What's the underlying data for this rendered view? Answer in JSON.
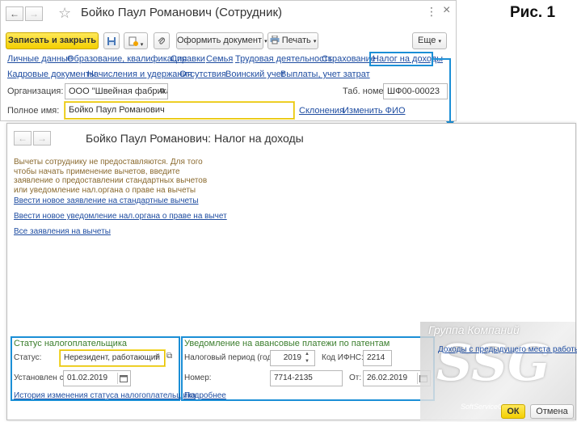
{
  "main_window": {
    "title": "Бойко Паул Романович (Сотрудник)",
    "more_icon": "⋮",
    "close_icon": "×",
    "toolbar": {
      "save_close": "Записать и закрыть",
      "create_document": "Оформить документ",
      "print": "Печать",
      "more": "Еще"
    },
    "nav_row1": [
      "Личные данные",
      "Образование, квалификация",
      "Справки",
      "Семья",
      "Трудовая деятельность",
      "Страхование",
      "Налог на доходы"
    ],
    "nav_row2": [
      "Кадровые документы",
      "Начисления и удержания",
      "Отсутствия",
      "Воинский учет",
      "Выплаты, учет затрат"
    ],
    "org_label": "Организация:",
    "org_value": "ООО \"Швейная фабрика\"",
    "tab_num_label": "Таб. номер:",
    "tab_num_value": "ШФ00-00023",
    "full_name_label": "Полное имя:",
    "full_name_value": "Бойко Паул Романович",
    "declensions": "Склонения",
    "change_name": "Изменить ФИО"
  },
  "annotation": {
    "figure_label": "Рис. 1",
    "highlight_color": "#1b8fd6"
  },
  "sub_window": {
    "title": "Бойко Паул Романович: Налог на доходы",
    "info_text": "Вычеты сотруднику не предоставляются. Для того чтобы начать применение вычетов, введите заявление о предоставлении стандартных вычетов или уведомление нал.органа о праве на вычеты",
    "links": [
      "Ввести новое заявление на стандартные вычеты",
      "Ввести новое уведомление нал.органа о праве на вычет",
      "Все заявления на вычеты"
    ],
    "status_group": {
      "title": "Статус налогоплательщика",
      "status_label": "Статус:",
      "status_value": "Нерезидент, работающий",
      "set_from_label": "Установлен с:",
      "set_from_value": "01.02.2019",
      "history_link": "История изменения статуса налогоплательщика"
    },
    "notice_group": {
      "title": "Уведомление на авансовые платежи по патентам",
      "period_label": "Налоговый период (год):",
      "period_value": "2019",
      "ifns_label": "Код ИФНС:",
      "ifns_value": "2214",
      "number_label": "Номер:",
      "number_value": "7714-2135",
      "from_label": "От:",
      "from_value": "26.02.2019",
      "more_link": "Подробнее"
    },
    "prev_income_link": "Доходы с предыдущего места работы",
    "ok": "ОК",
    "cancel": "Отмена"
  },
  "watermark": {
    "company": "Группа Компаний",
    "logo": "SSG",
    "site": "SoftServiceGold"
  }
}
